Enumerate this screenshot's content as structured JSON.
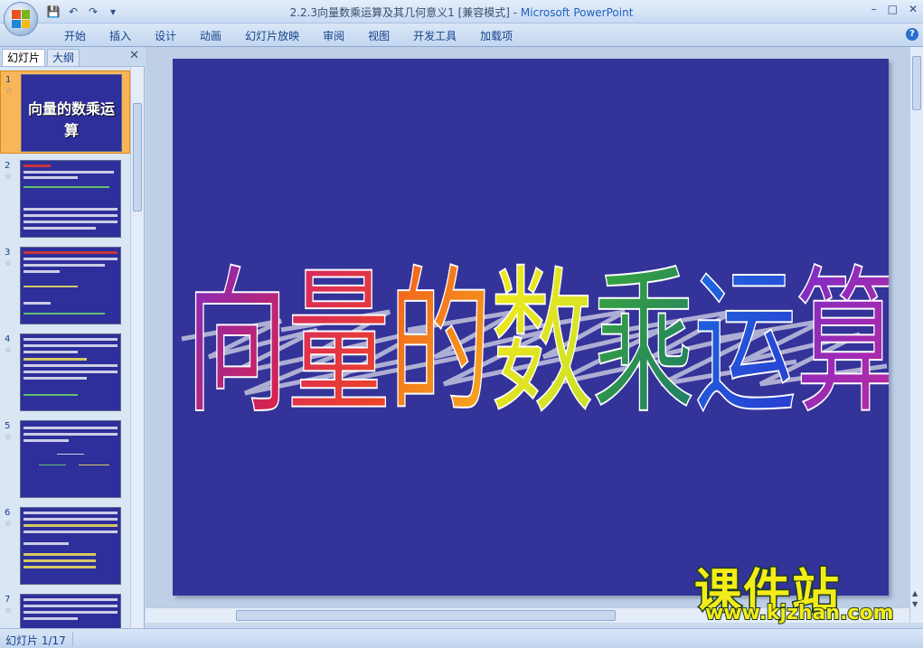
{
  "window": {
    "title": "2.2.3向量数乘运算及其几何意义1 [兼容模式] - ",
    "app_name": "Microsoft PowerPoint",
    "controls": [
      "–",
      "□",
      "✕"
    ]
  },
  "quick_access": {
    "icons": [
      "save-icon",
      "undo-icon",
      "redo-icon",
      "customize-icon"
    ],
    "glyphs": [
      "💾",
      "↶",
      "↷",
      "▾"
    ]
  },
  "ribbon": {
    "tabs": [
      "开始",
      "插入",
      "设计",
      "动画",
      "幻灯片放映",
      "审阅",
      "视图",
      "开发工具",
      "加载项"
    ],
    "help": "?"
  },
  "left_panel": {
    "tab_slides": "幻灯片",
    "tab_outline": "大纲",
    "close": "✕",
    "thumbnails": [
      {
        "num": "1",
        "title": "向量的数乘运算",
        "selected": true
      },
      {
        "num": "2",
        "selected": false
      },
      {
        "num": "3",
        "selected": false
      },
      {
        "num": "4",
        "selected": false
      },
      {
        "num": "5",
        "selected": false
      },
      {
        "num": "6",
        "selected": false
      },
      {
        "num": "7",
        "selected": false
      }
    ],
    "star": "☆"
  },
  "slide": {
    "title_chars": [
      "向",
      "量",
      "的",
      "数",
      "乘",
      "运",
      "算"
    ],
    "title_colors": [
      "#c1338f",
      "#e8213a",
      "#f07a1c",
      "#f4e81c",
      "#2e9a3a",
      "#2a5ce0",
      "#7a2cc8"
    ],
    "background": "#333399"
  },
  "status": {
    "slide_counter": "幻灯片 1/17"
  },
  "watermark": {
    "cn": "课件站",
    "url": "www.kjzhan.com"
  }
}
